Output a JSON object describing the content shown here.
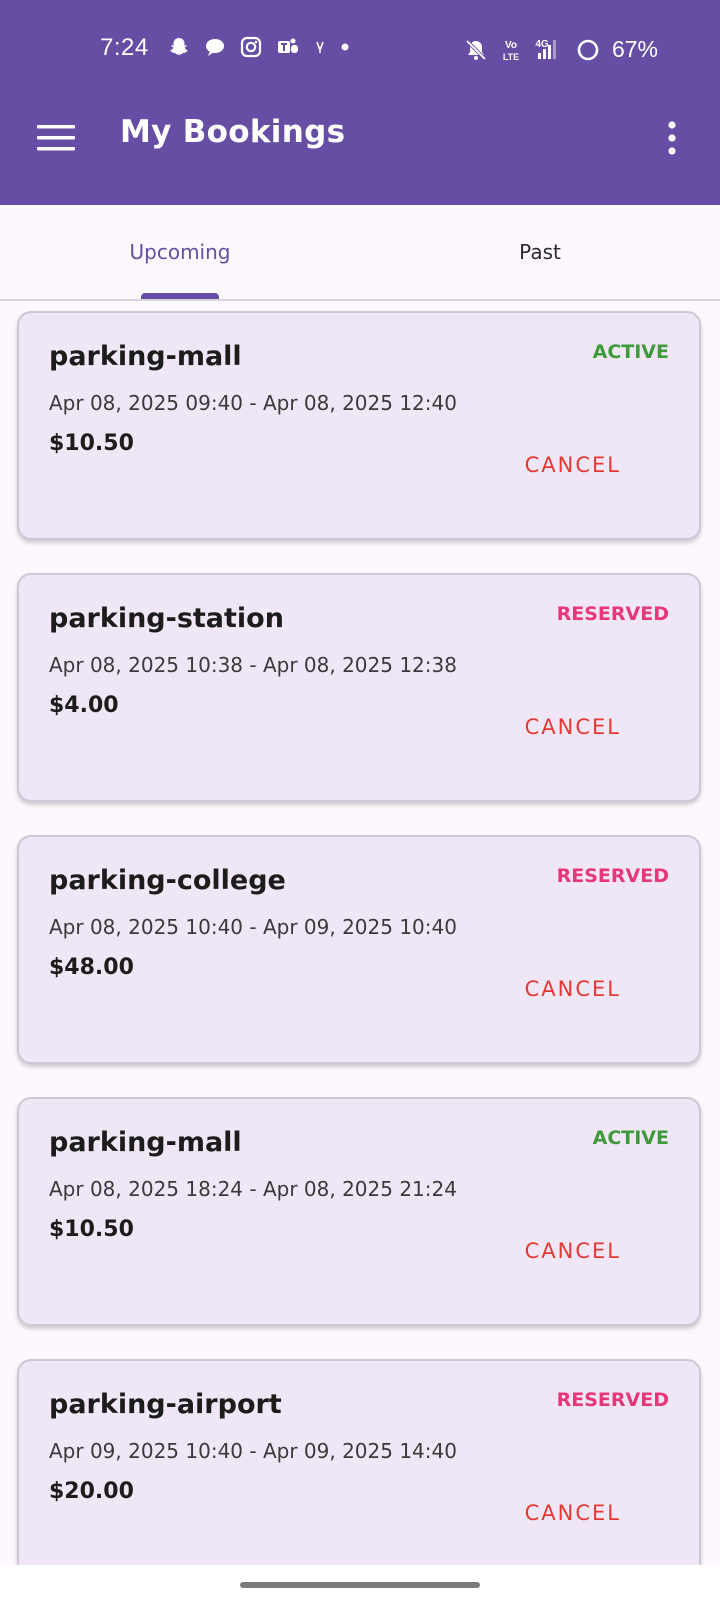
{
  "status_bar": {
    "time": "7:24",
    "battery": "67%",
    "left_icons": [
      "snapchat-icon",
      "chat-bubble-icon",
      "instagram-icon",
      "teams-icon",
      "notification-icon",
      "dot-icon"
    ],
    "right_icons": [
      "bell-off-icon",
      "volte-icon",
      "signal-4g-icon",
      "battery-ring-icon"
    ],
    "volte_text": "Vo LTE",
    "network_text": "4G"
  },
  "app_bar": {
    "title": "My Bookings",
    "menu_icon": "hamburger-menu-icon",
    "more_icon": "more-vert-icon",
    "background": "#654ea3"
  },
  "tabs": [
    {
      "label": "Upcoming",
      "selected": true
    },
    {
      "label": "Past",
      "selected": false
    }
  ],
  "colors": {
    "accent": "#654ea3",
    "active": "#3e9a3a",
    "reserved": "#e8367a",
    "cancel": "#e53935",
    "card_bg": "#efe7f5"
  },
  "bookings": [
    {
      "name": "parking-mall",
      "status": "ACTIVE",
      "dates": "Apr 08, 2025 09:40 - Apr 08, 2025 12:40",
      "price": "$10.50",
      "action": "CANCEL"
    },
    {
      "name": "parking-station",
      "status": "RESERVED",
      "dates": "Apr 08, 2025 10:38 - Apr 08, 2025 12:38",
      "price": "$4.00",
      "action": "CANCEL"
    },
    {
      "name": "parking-college",
      "status": "RESERVED",
      "dates": "Apr 08, 2025 10:40 - Apr 09, 2025 10:40",
      "price": "$48.00",
      "action": "CANCEL"
    },
    {
      "name": "parking-mall",
      "status": "ACTIVE",
      "dates": "Apr 08, 2025 18:24 - Apr 08, 2025 21:24",
      "price": "$10.50",
      "action": "CANCEL"
    },
    {
      "name": "parking-airport",
      "status": "RESERVED",
      "dates": "Apr 09, 2025 10:40 - Apr 09, 2025 14:40",
      "price": "$20.00",
      "action": "CANCEL"
    }
  ]
}
